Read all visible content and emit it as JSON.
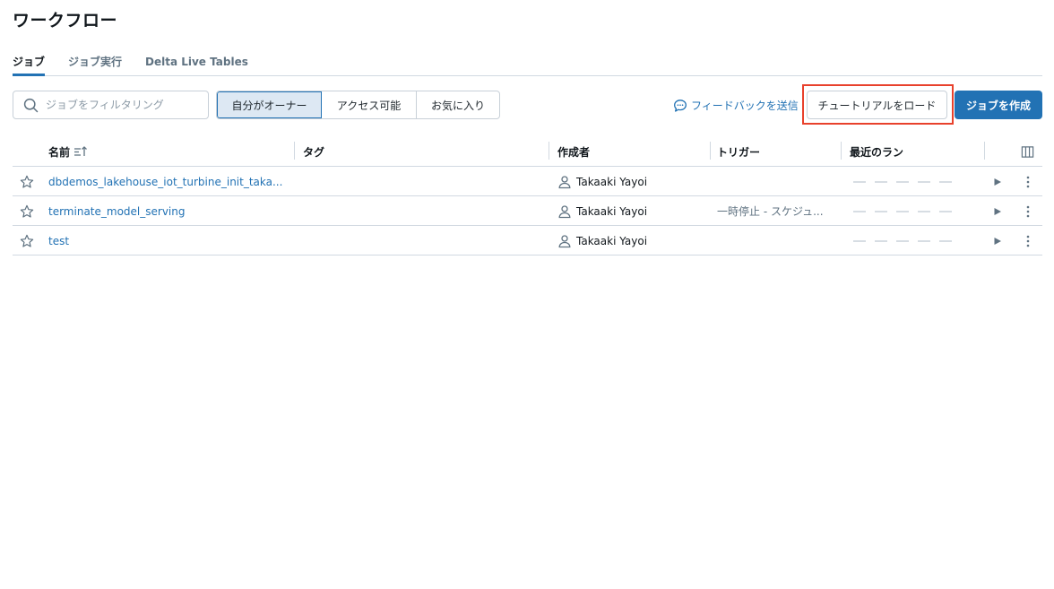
{
  "page": {
    "title": "ワークフロー"
  },
  "tabs": [
    {
      "label": "ジョブ",
      "active": true
    },
    {
      "label": "ジョブ実行",
      "active": false
    },
    {
      "label": "Delta Live Tables",
      "active": false
    }
  ],
  "filter": {
    "search_placeholder": "ジョブをフィルタリング",
    "segments": [
      {
        "label": "自分がオーナー",
        "active": true
      },
      {
        "label": "アクセス可能",
        "active": false
      },
      {
        "label": "お気に入り",
        "active": false
      }
    ]
  },
  "actions": {
    "feedback_label": "フィードバックを送信",
    "tutorial_label": "チュートリアルをロード",
    "create_label": "ジョブを作成"
  },
  "table": {
    "headers": {
      "name": "名前",
      "tags": "タグ",
      "creator": "作成者",
      "trigger": "トリガー",
      "recent_runs": "最近のラン"
    },
    "rows": [
      {
        "name": "dbdemos_lakehouse_iot_turbine_init_taka...",
        "creator": "Takaaki Yayoi",
        "trigger": ""
      },
      {
        "name": "terminate_model_serving",
        "creator": "Takaaki Yayoi",
        "trigger": "一時停止 - スケジュ..."
      },
      {
        "name": "test",
        "creator": "Takaaki Yayoi",
        "trigger": ""
      }
    ]
  },
  "colors": {
    "accent": "#2272b4",
    "highlight_border": "#e8412c"
  }
}
